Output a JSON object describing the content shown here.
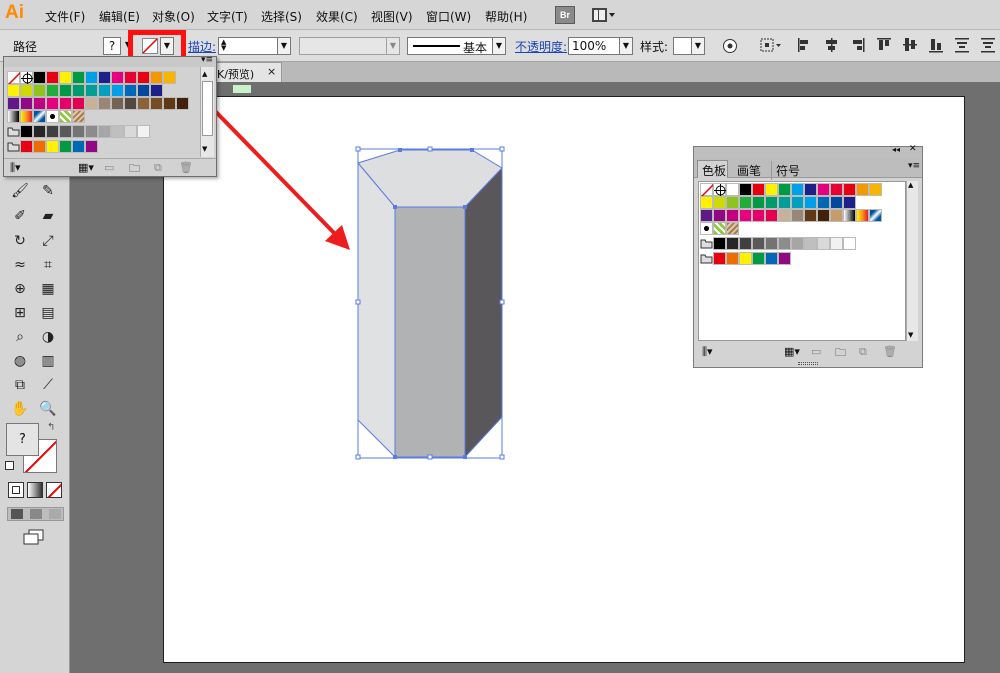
{
  "app": {
    "logo": "Ai",
    "br_label": "Br"
  },
  "menu": [
    {
      "label": "文件(F)"
    },
    {
      "label": "编辑(E)"
    },
    {
      "label": "对象(O)"
    },
    {
      "label": "文字(T)"
    },
    {
      "label": "选择(S)"
    },
    {
      "label": "效果(C)"
    },
    {
      "label": "视图(V)"
    },
    {
      "label": "窗口(W)"
    },
    {
      "label": "帮助(H)"
    }
  ],
  "options": {
    "selection_label": "路径",
    "fill_value": "?",
    "stroke_label": "描边:",
    "stroke_profile": "基本",
    "opacity_label": "不透明度:",
    "opacity_value": "100%",
    "style_label": "样式:"
  },
  "document": {
    "tab_label": "K/预览)",
    "close": "×"
  },
  "toolbox": {
    "fill_question": "?"
  },
  "swatch_panel": {
    "tabs": [
      "色板",
      "画笔",
      "符号"
    ]
  },
  "colors": {
    "row1": [
      "#ffffff",
      "#000000",
      "#e60012",
      "#fff100",
      "#009944",
      "#00a0e9",
      "#1d2088",
      "#e4007f",
      "#e60033",
      "#e60012",
      "#f39800",
      "#f8b500"
    ],
    "row2": [
      "#fff100",
      "#cfdb00",
      "#8fc31f",
      "#22ac38",
      "#009944",
      "#009b6b",
      "#009e96",
      "#00a0c1",
      "#00a0e9",
      "#0068b7",
      "#00479d",
      "#1d2088"
    ],
    "row3": [
      "#601986",
      "#920783",
      "#be0081",
      "#e4007f",
      "#e5006a",
      "#e5004f",
      "#c7b299",
      "#998675",
      "#736357",
      "#534741",
      "#c69c6d",
      "#a67c52"
    ],
    "row4": [
      "#8c6239",
      "#754c24",
      "#603813",
      "#42210b"
    ],
    "gray": [
      "#000000",
      "#262626",
      "#404040",
      "#595959",
      "#737373",
      "#8c8c8c",
      "#a6a6a6",
      "#bfbfbf",
      "#d9d9d9",
      "#f2f2f2",
      "#ffffff"
    ],
    "group": [
      "#e60012",
      "#ed6d00",
      "#fff100",
      "#009944",
      "#0068b7",
      "#920783"
    ]
  }
}
